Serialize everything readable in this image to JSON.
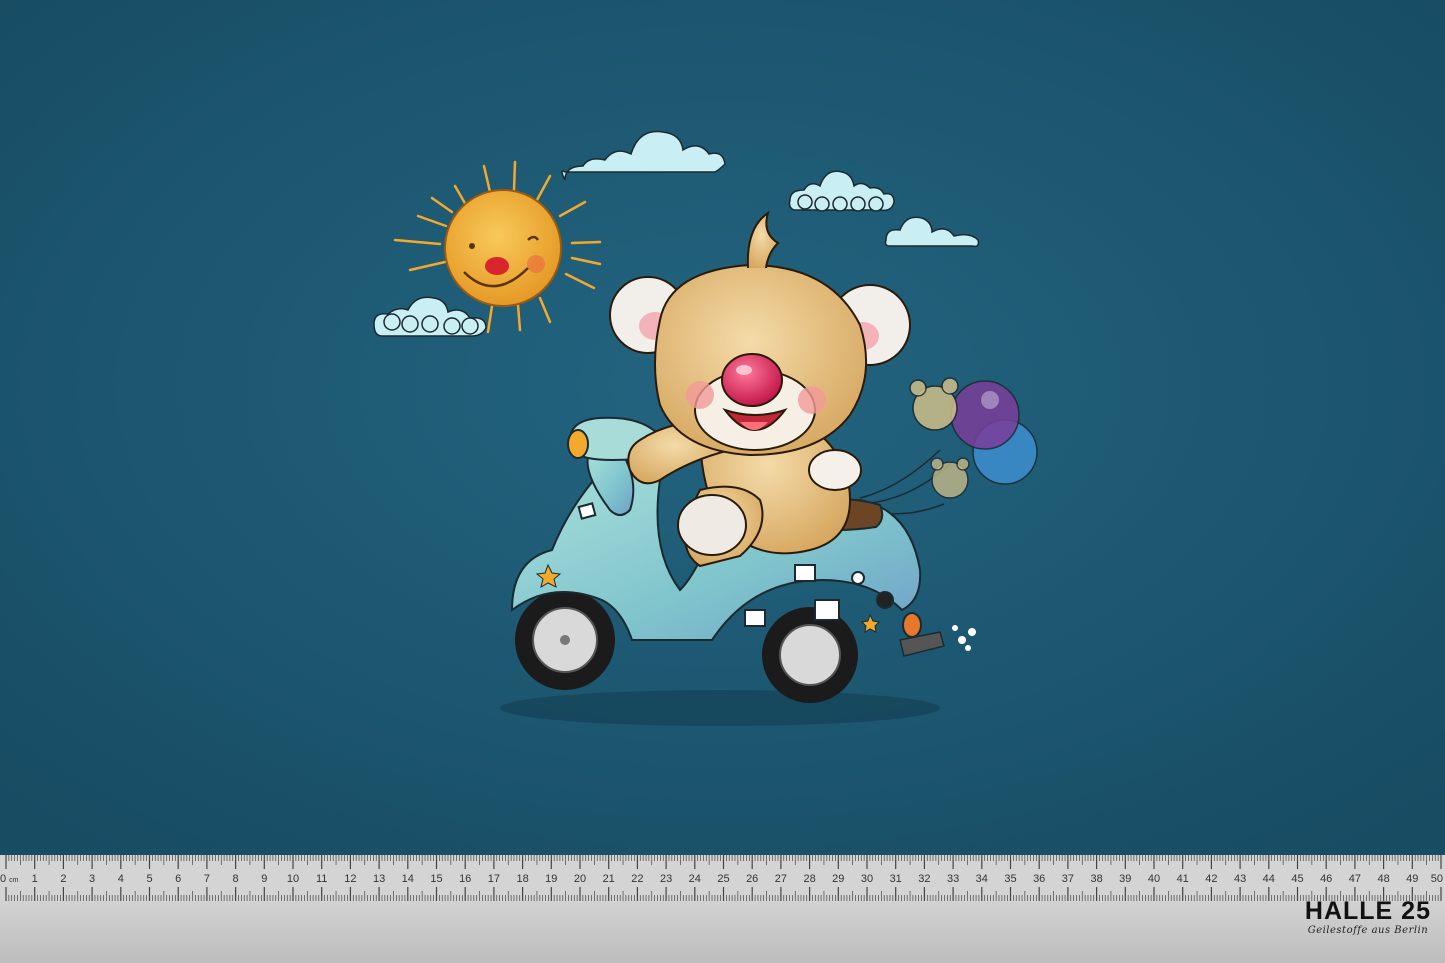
{
  "colors": {
    "fabric": "#1d5872",
    "sun": "#f2a92c",
    "bear_fur": "#e8c48a",
    "scooter": "#8fcfcf",
    "cloud": "#c9eef3",
    "ruler": "#c9c9c9"
  },
  "ruler": {
    "unit": "cm",
    "zero_label": "0",
    "max": 50
  },
  "brand": {
    "name": "HALLE 25",
    "tagline": "Geilestoffe aus Berlin"
  }
}
